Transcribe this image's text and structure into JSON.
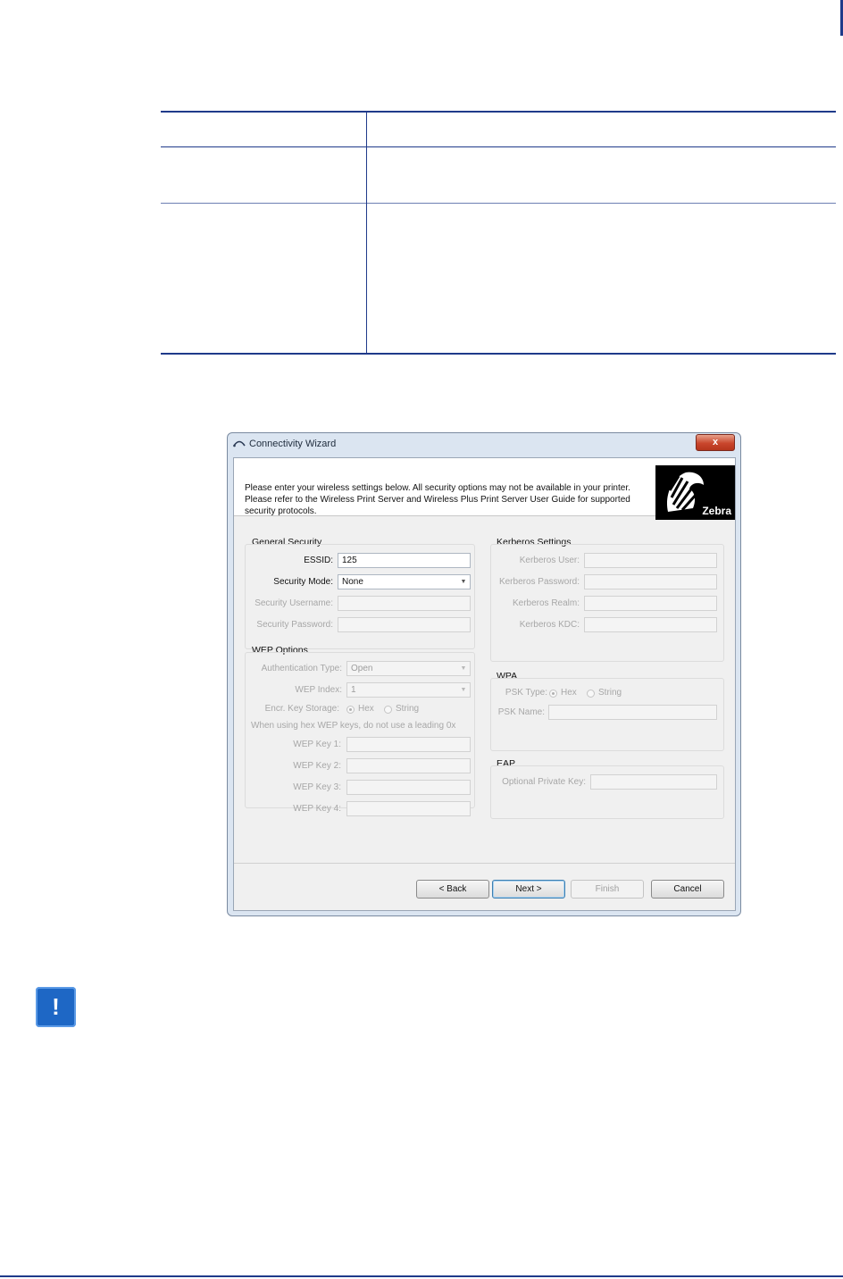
{
  "dialog": {
    "title": "Connectivity Wizard",
    "close_label": "x",
    "intro_text": "Please enter your wireless settings below.  All security options may not be available in your printer. Please refer to the Wireless Print Server and Wireless Plus Print Server User Guide for supported security protocols.",
    "logo_text": "Zebra",
    "general_security": {
      "label": "General Security",
      "essid_label": "ESSID:",
      "essid_value": "125",
      "security_mode_label": "Security Mode:",
      "security_mode_value": "None",
      "security_username_label": "Security Username:",
      "security_password_label": "Security Password:"
    },
    "wep_options": {
      "label": "WEP Options",
      "auth_type_label": "Authentication Type:",
      "auth_type_value": "Open",
      "wep_index_label": "WEP Index:",
      "wep_index_value": "1",
      "encr_key_storage_label": "Encr. Key Storage:",
      "hex_label": "Hex",
      "string_label": "String",
      "hint": "When using hex WEP keys, do not use a leading 0x",
      "key1_label": "WEP Key 1:",
      "key2_label": "WEP Key 2:",
      "key3_label": "WEP Key 3:",
      "key4_label": "WEP Key 4:"
    },
    "kerberos": {
      "label": "Kerberos Settings",
      "user_label": "Kerberos User:",
      "password_label": "Kerberos Password:",
      "realm_label": "Kerberos Realm:",
      "kdc_label": "Kerberos KDC:"
    },
    "wpa": {
      "label": "WPA",
      "psk_type_label": "PSK Type:",
      "hex_label": "Hex",
      "string_label": "String",
      "psk_name_label": "PSK Name:"
    },
    "eap": {
      "label": "EAP",
      "private_key_label": "Optional Private Key:"
    },
    "buttons": {
      "back": "< Back",
      "next": "Next >",
      "finish": "Finish",
      "cancel": "Cancel"
    }
  },
  "note_icon": "important-icon",
  "colors": {
    "rule_blue": "#1f3a8a",
    "note_blue": "#1e67c5"
  }
}
